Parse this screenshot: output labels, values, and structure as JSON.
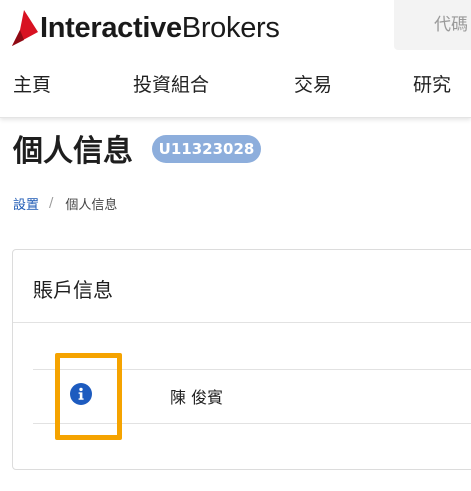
{
  "brand": {
    "name_bold": "Interactive",
    "name_regular": "Brokers",
    "accent_color": "#d81222"
  },
  "search": {
    "placeholder": "代碼"
  },
  "nav": {
    "items": [
      {
        "label": "主頁"
      },
      {
        "label": "投資組合"
      },
      {
        "label": "交易"
      },
      {
        "label": "研究"
      }
    ]
  },
  "page": {
    "title": "個人信息",
    "account_id": "U11323028"
  },
  "breadcrumb": {
    "parent": "設置",
    "separator": "/",
    "current": "個人信息"
  },
  "account_card": {
    "title": "賬戶信息",
    "name_value": "陳 俊賓",
    "info_icon": "info-icon"
  },
  "colors": {
    "badge": "#8daedc",
    "link": "#1f5bb5",
    "highlight": "#f5a300",
    "info_icon": "#1d5bbf"
  }
}
